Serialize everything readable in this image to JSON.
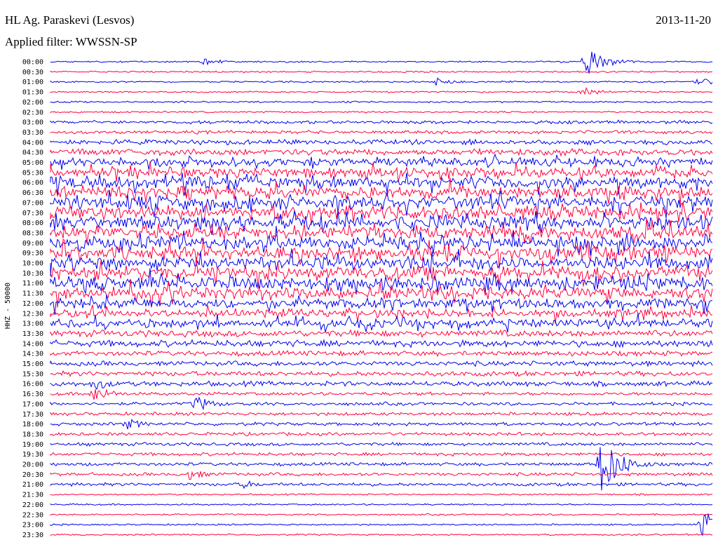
{
  "header": {
    "station": "HL Ag. Paraskevi (Lesvos)",
    "filter": "Applied filter: WWSSN-SP",
    "date": "2013-11-20"
  },
  "colors": {
    "odd_trace": "#0000ee",
    "even_trace": "#ff0040",
    "background": "#ffffff"
  },
  "chart_data": {
    "type": "line",
    "title": "HL Ag. Paraskevi (Lesvos)",
    "subtitle": "Applied filter: WWSSN-SP",
    "ylabel": "HHZ - 50000",
    "xlabel": "",
    "grid": false,
    "legend": "none",
    "rows": [
      "00:00",
      "00:30",
      "01:00",
      "01:30",
      "02:00",
      "02:30",
      "03:00",
      "03:30",
      "04:00",
      "04:30",
      "05:00",
      "05:30",
      "06:00",
      "06:30",
      "07:00",
      "07:30",
      "08:00",
      "08:30",
      "09:00",
      "09:30",
      "10:00",
      "10:30",
      "11:00",
      "11:30",
      "12:00",
      "12:30",
      "13:00",
      "13:30",
      "14:00",
      "14:30",
      "15:00",
      "15:30",
      "16:00",
      "16:30",
      "17:00",
      "17:30",
      "18:00",
      "18:30",
      "19:00",
      "19:30",
      "20:00",
      "20:30",
      "21:00",
      "21:30",
      "22:00",
      "22:30",
      "23:00",
      "23:30"
    ],
    "row_noise_amplitude": [
      1,
      1,
      1,
      1,
      1,
      1,
      2,
      2,
      3,
      4,
      5,
      6,
      7,
      7,
      8,
      8,
      8,
      8,
      8,
      8,
      8,
      8,
      8,
      7,
      6,
      5,
      5,
      4,
      4,
      3,
      3,
      3,
      3,
      2,
      2,
      2,
      2,
      2,
      2,
      2,
      2,
      2,
      2,
      1,
      1,
      1,
      1,
      1
    ],
    "events": [
      {
        "row": "00:00",
        "minute": 7.0,
        "amplitude": 6
      },
      {
        "row": "00:00",
        "minute": 24.3,
        "amplitude": 22
      },
      {
        "row": "01:00",
        "minute": 17.5,
        "amplitude": 6
      },
      {
        "row": "01:00",
        "minute": 29.4,
        "amplitude": 6
      },
      {
        "row": "01:30",
        "minute": 24.2,
        "amplitude": 7
      },
      {
        "row": "16:00",
        "minute": 2.0,
        "amplitude": 10
      },
      {
        "row": "16:30",
        "minute": 2.0,
        "amplitude": 12
      },
      {
        "row": "17:00",
        "minute": 6.6,
        "amplitude": 12
      },
      {
        "row": "18:00",
        "minute": 3.5,
        "amplitude": 8
      },
      {
        "row": "20:00",
        "minute": 25.0,
        "amplitude": 45
      },
      {
        "row": "20:30",
        "minute": 6.3,
        "amplitude": 8
      },
      {
        "row": "21:00",
        "minute": 8.8,
        "amplitude": 6
      },
      {
        "row": "23:00",
        "minute": 29.6,
        "amplitude": 20
      }
    ]
  }
}
